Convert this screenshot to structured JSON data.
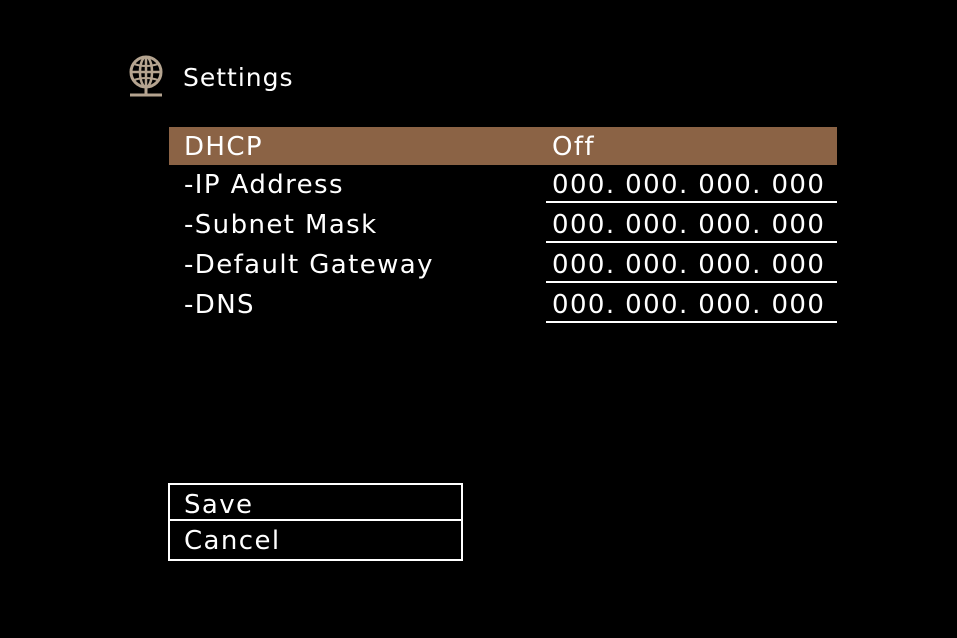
{
  "header": {
    "icon": "globe-network-icon",
    "title": "Settings"
  },
  "colors": {
    "background": "#000000",
    "selected_row": "#8b6345",
    "text": "#ffffff",
    "icon": "#b5a490"
  },
  "settings": {
    "dhcp": {
      "label": "DHCP",
      "value": "Off"
    },
    "ip_address": {
      "label": "-IP Address",
      "value": "000. 000. 000. 000"
    },
    "subnet_mask": {
      "label": "-Subnet Mask",
      "value": "000. 000. 000. 000"
    },
    "default_gateway": {
      "label": "-Default Gateway",
      "value": "000. 000. 000. 000"
    },
    "dns": {
      "label": "-DNS",
      "value": "000. 000. 000. 000"
    }
  },
  "actions": {
    "save_label": "Save",
    "cancel_label": "Cancel"
  }
}
